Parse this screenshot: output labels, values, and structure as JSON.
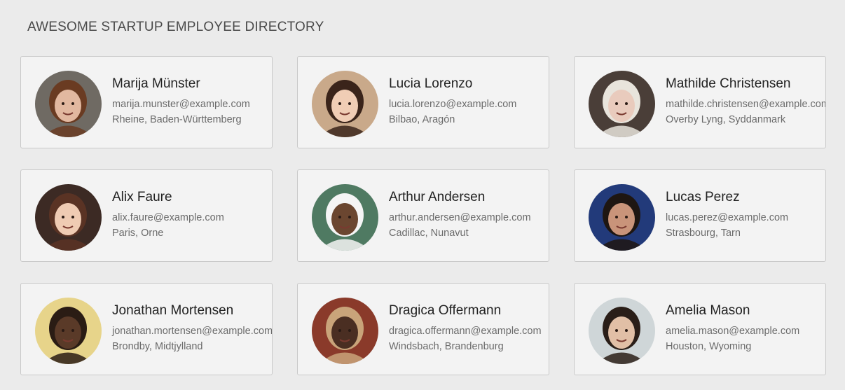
{
  "page": {
    "title": "AWESOME STARTUP EMPLOYEE DIRECTORY"
  },
  "employees": [
    {
      "name": "Marija Münster",
      "email": "marija.munster@example.com",
      "location": "Rheine, Baden-Württemberg",
      "colors": {
        "bg": "#6f6a63",
        "skin": "#e2b8a0",
        "hair": "#6a3b22"
      }
    },
    {
      "name": "Lucia Lorenzo",
      "email": "lucia.lorenzo@example.com",
      "location": "Bilbao, Aragón",
      "colors": {
        "bg": "#c9a98a",
        "skin": "#f0cdb5",
        "hair": "#3a241a"
      }
    },
    {
      "name": "Mathilde Christensen",
      "email": "mathilde.christensen@example.com",
      "location": "Overby Lyng, Syddanmark",
      "colors": {
        "bg": "#4a3e38",
        "skin": "#e9cbbd",
        "hair": "#e8e4dc"
      }
    },
    {
      "name": "Alix Faure",
      "email": "alix.faure@example.com",
      "location": "Paris, Orne",
      "colors": {
        "bg": "#3c2a24",
        "skin": "#efcbb3",
        "hair": "#5a3324"
      }
    },
    {
      "name": "Arthur Andersen",
      "email": "arthur.andersen@example.com",
      "location": "Cadillac, Nunavut",
      "colors": {
        "bg": "#4f7a62",
        "skin": "#6b4630",
        "hair": "#f5f5f5"
      }
    },
    {
      "name": "Lucas Perez",
      "email": "lucas.perez@example.com",
      "location": "Strasbourg, Tarn",
      "colors": {
        "bg": "#223a7a",
        "skin": "#c9947a",
        "hair": "#1e1612"
      }
    },
    {
      "name": "Jonathan Mortensen",
      "email": "jonathan.mortensen@example.com",
      "location": "Brondby, Midtjylland",
      "colors": {
        "bg": "#e7d48a",
        "skin": "#5a3a28",
        "hair": "#2a1c14"
      }
    },
    {
      "name": "Dragica Offermann",
      "email": "dragica.offermann@example.com",
      "location": "Windsbach, Brandenburg",
      "colors": {
        "bg": "#8a3a2a",
        "skin": "#4a2e22",
        "hair": "#c9a47a"
      }
    },
    {
      "name": "Amelia Mason",
      "email": "amelia.mason@example.com",
      "location": "Houston, Wyoming",
      "colors": {
        "bg": "#cfd6d8",
        "skin": "#e1bfa6",
        "hair": "#2a1e18"
      }
    }
  ]
}
